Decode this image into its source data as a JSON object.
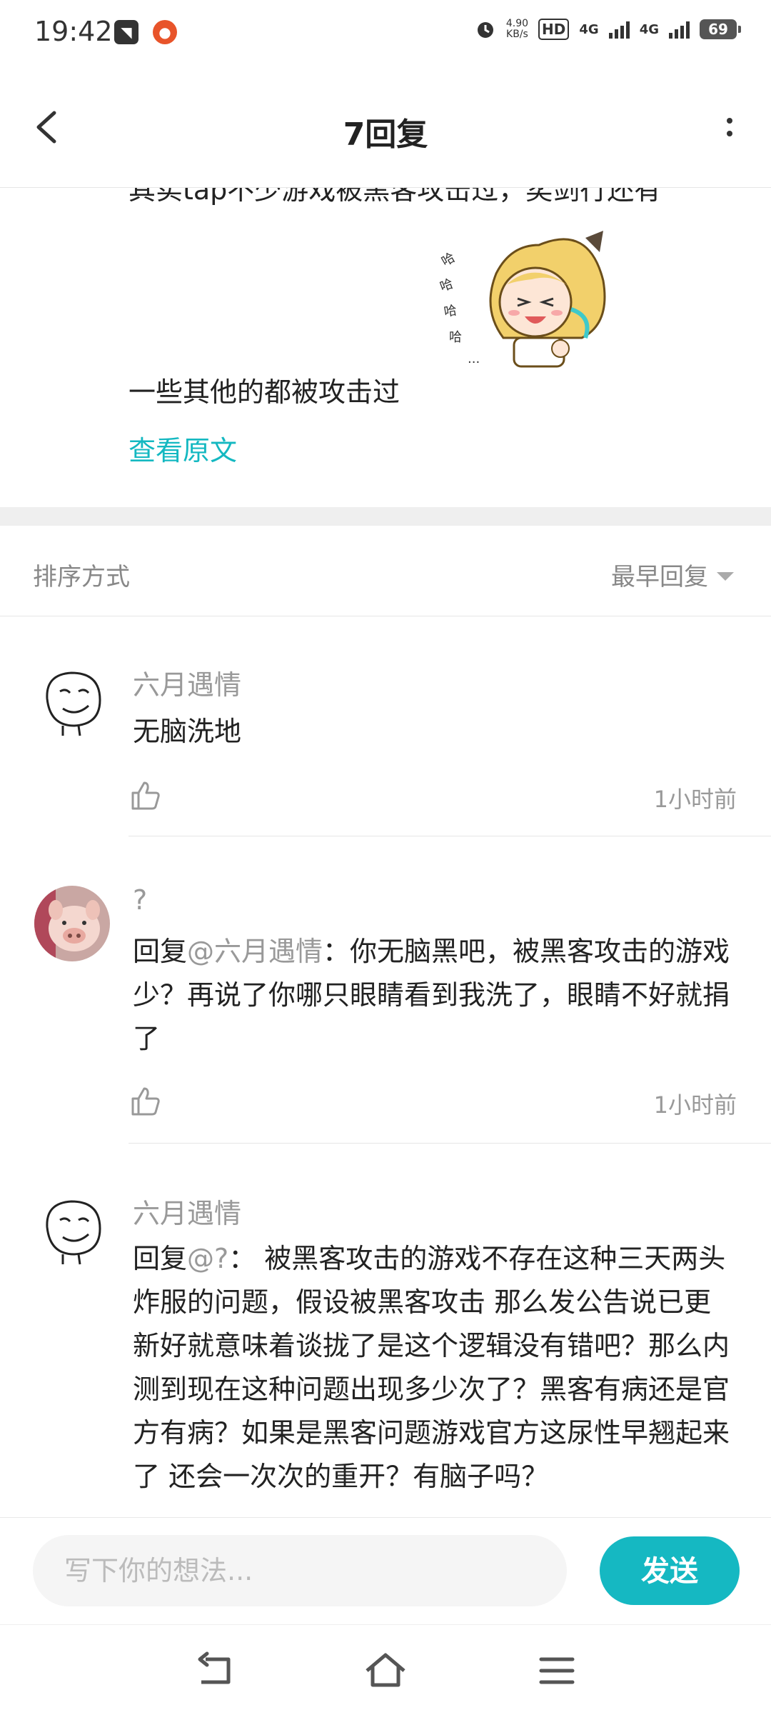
{
  "status_bar": {
    "time": "19:42",
    "net_speed_value": "4.90",
    "net_speed_unit": "KB/s",
    "hd_label": "HD",
    "sim1_label": "4G",
    "sim2_label": "4G",
    "battery": "69"
  },
  "header": {
    "title": "7回复"
  },
  "original_post": {
    "line1": "其实tap不少游戏被黑客攻击过，奕剑行还有",
    "line2": "一些其他的都被攻击过",
    "view_original_label": "查看原文"
  },
  "sort": {
    "label": "排序方式",
    "selected": "最早回复"
  },
  "comments": [
    {
      "author": "六月遇情",
      "content": "无脑洗地",
      "time": "1小时前",
      "avatar": "smiley-sketch"
    },
    {
      "author": "?",
      "reply_prefix": "回复",
      "mention": "@六月遇情",
      "content": "：你无脑黑吧，被黑客攻击的游戏少？再说了你哪只眼睛看到我洗了，眼睛不好就捐了",
      "time": "1小时前",
      "avatar": "pig-photo"
    },
    {
      "author": "六月遇情",
      "reply_prefix": "回复",
      "mention": "@?",
      "content": "： 被黑客攻击的游戏不存在这种三天两头炸服的问题，假设被黑客攻击  那么发公告说已更新好就意味着谈拢了是这个逻辑没有错吧？那么内测到现在这种问题出现多少次了？黑客有病还是官方有病？如果是黑客问题游戏官方这尿性早翘起来了 还会一次次的重开？有脑子吗？",
      "avatar": "smiley-sketch"
    }
  ],
  "input": {
    "placeholder": "写下你的想法...",
    "send_label": "发送"
  },
  "colors": {
    "accent": "#15b8c2",
    "muted_text": "#999999"
  }
}
